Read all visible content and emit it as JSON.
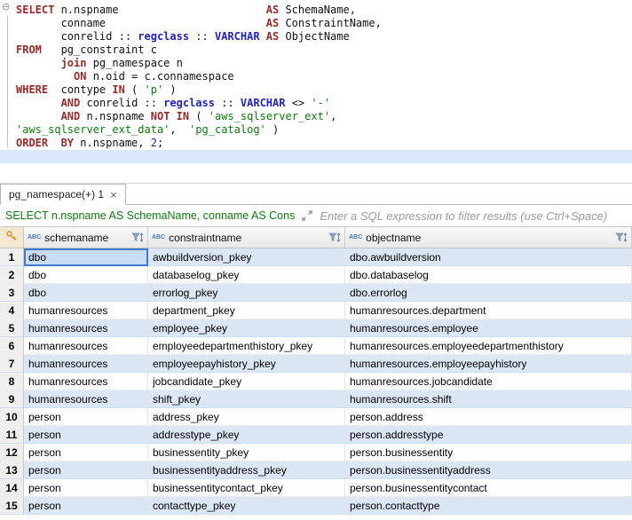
{
  "colors": {
    "keyword": "#9a2a2a",
    "string": "#0a7d0a",
    "datatype": "#2222c2",
    "caret_line": "#d9e9fb",
    "selection_border": "#4079d0",
    "zebra_row": "#dce7f5",
    "filter_text_green": "#0a7d0a"
  },
  "editor": {
    "fold_icon": "⊖",
    "lines": [
      {
        "tokens": [
          {
            "t": "SELECT",
            "c": "kw"
          },
          {
            "t": " n.nspname                       ",
            "c": "pl"
          },
          {
            "t": "AS",
            "c": "kw"
          },
          {
            "t": " SchemaName,",
            "c": "pl"
          }
        ]
      },
      {
        "tokens": [
          {
            "t": "       conname                         ",
            "c": "pl"
          },
          {
            "t": "AS",
            "c": "kw"
          },
          {
            "t": " ConstraintName,",
            "c": "pl"
          }
        ]
      },
      {
        "tokens": [
          {
            "t": "       conrelid :: ",
            "c": "pl"
          },
          {
            "t": "regclass",
            "c": "ty"
          },
          {
            "t": " :: ",
            "c": "pl"
          },
          {
            "t": "VARCHAR",
            "c": "ty"
          },
          {
            "t": " ",
            "c": "pl"
          },
          {
            "t": "AS",
            "c": "kw"
          },
          {
            "t": " ObjectName",
            "c": "pl"
          }
        ]
      },
      {
        "tokens": [
          {
            "t": "FROM",
            "c": "kw"
          },
          {
            "t": "   pg_constraint c",
            "c": "pl"
          }
        ]
      },
      {
        "tokens": [
          {
            "t": "       ",
            "c": "pl"
          },
          {
            "t": "join",
            "c": "kw"
          },
          {
            "t": " pg_namespace n",
            "c": "pl"
          }
        ]
      },
      {
        "tokens": [
          {
            "t": "         ",
            "c": "pl"
          },
          {
            "t": "ON",
            "c": "kw"
          },
          {
            "t": " n.oid = c.connamespace",
            "c": "pl"
          }
        ]
      },
      {
        "tokens": [
          {
            "t": "WHERE",
            "c": "kw"
          },
          {
            "t": "  contype ",
            "c": "pl"
          },
          {
            "t": "IN",
            "c": "kw"
          },
          {
            "t": " ( ",
            "c": "pl"
          },
          {
            "t": "'p'",
            "c": "str"
          },
          {
            "t": " )",
            "c": "pl"
          }
        ]
      },
      {
        "tokens": [
          {
            "t": "       ",
            "c": "pl"
          },
          {
            "t": "AND",
            "c": "kw"
          },
          {
            "t": " conrelid :: ",
            "c": "pl"
          },
          {
            "t": "regclass",
            "c": "ty"
          },
          {
            "t": " :: ",
            "c": "pl"
          },
          {
            "t": "VARCHAR",
            "c": "ty"
          },
          {
            "t": " <> ",
            "c": "pl"
          },
          {
            "t": "'-'",
            "c": "str"
          }
        ]
      },
      {
        "tokens": [
          {
            "t": "       ",
            "c": "pl"
          },
          {
            "t": "AND",
            "c": "kw"
          },
          {
            "t": " n.nspname ",
            "c": "pl"
          },
          {
            "t": "NOT IN",
            "c": "kw"
          },
          {
            "t": " ( ",
            "c": "pl"
          },
          {
            "t": "'aws_sqlserver_ext'",
            "c": "str"
          },
          {
            "t": ",",
            "c": "pl"
          }
        ]
      },
      {
        "tokens": [
          {
            "t": "'aws_sqlserver_ext_data'",
            "c": "str"
          },
          {
            "t": ",  ",
            "c": "pl"
          },
          {
            "t": "'pg_catalog'",
            "c": "str"
          },
          {
            "t": " )",
            "c": "pl"
          }
        ]
      },
      {
        "tokens": [
          {
            "t": "ORDER",
            "c": "kw"
          },
          {
            "t": "  ",
            "c": "pl"
          },
          {
            "t": "BY",
            "c": "kw"
          },
          {
            "t": " n.nspname, ",
            "c": "pl"
          },
          {
            "t": "2",
            "c": "num"
          },
          {
            "t": ";",
            "c": "pl"
          }
        ]
      },
      {
        "caret": true,
        "tokens": []
      }
    ]
  },
  "results": {
    "tab": {
      "label": "pg_namespace(+) 1",
      "close": "×"
    },
    "filter": {
      "query": "SELECT n.nspname AS SchemaName, conname AS Cons",
      "placeholder": "Enter a SQL expression to filter results (use Ctrl+Space)"
    },
    "table": {
      "columns": [
        {
          "label": "schemaname",
          "type_icon": "ABC"
        },
        {
          "label": "constraintname",
          "type_icon": "ABC"
        },
        {
          "label": "objectname",
          "type_icon": "ABC"
        }
      ],
      "rows": [
        {
          "num": "1",
          "selected_cell": 0,
          "cells": [
            "dbo",
            "awbuildversion_pkey",
            "dbo.awbuildversion"
          ]
        },
        {
          "num": "2",
          "cells": [
            "dbo",
            "databaselog_pkey",
            "dbo.databaselog"
          ]
        },
        {
          "num": "3",
          "cells": [
            "dbo",
            "errorlog_pkey",
            "dbo.errorlog"
          ]
        },
        {
          "num": "4",
          "cells": [
            "humanresources",
            "department_pkey",
            "humanresources.department"
          ]
        },
        {
          "num": "5",
          "cells": [
            "humanresources",
            "employee_pkey",
            "humanresources.employee"
          ]
        },
        {
          "num": "6",
          "cells": [
            "humanresources",
            "employeedepartmenthistory_pkey",
            "humanresources.employeedepartmenthistory"
          ]
        },
        {
          "num": "7",
          "cells": [
            "humanresources",
            "employeepayhistory_pkey",
            "humanresources.employeepayhistory"
          ]
        },
        {
          "num": "8",
          "cells": [
            "humanresources",
            "jobcandidate_pkey",
            "humanresources.jobcandidate"
          ]
        },
        {
          "num": "9",
          "cells": [
            "humanresources",
            "shift_pkey",
            "humanresources.shift"
          ]
        },
        {
          "num": "10",
          "cells": [
            "person",
            "address_pkey",
            "person.address"
          ]
        },
        {
          "num": "11",
          "cells": [
            "person",
            "addresstype_pkey",
            "person.addresstype"
          ]
        },
        {
          "num": "12",
          "cells": [
            "person",
            "businessentity_pkey",
            "person.businessentity"
          ]
        },
        {
          "num": "13",
          "cells": [
            "person",
            "businessentityaddress_pkey",
            "person.businessentityaddress"
          ]
        },
        {
          "num": "14",
          "cells": [
            "person",
            "businessentitycontact_pkey",
            "person.businessentitycontact"
          ]
        },
        {
          "num": "15",
          "cells": [
            "person",
            "contacttype_pkey",
            "person.contacttype"
          ]
        }
      ]
    }
  }
}
